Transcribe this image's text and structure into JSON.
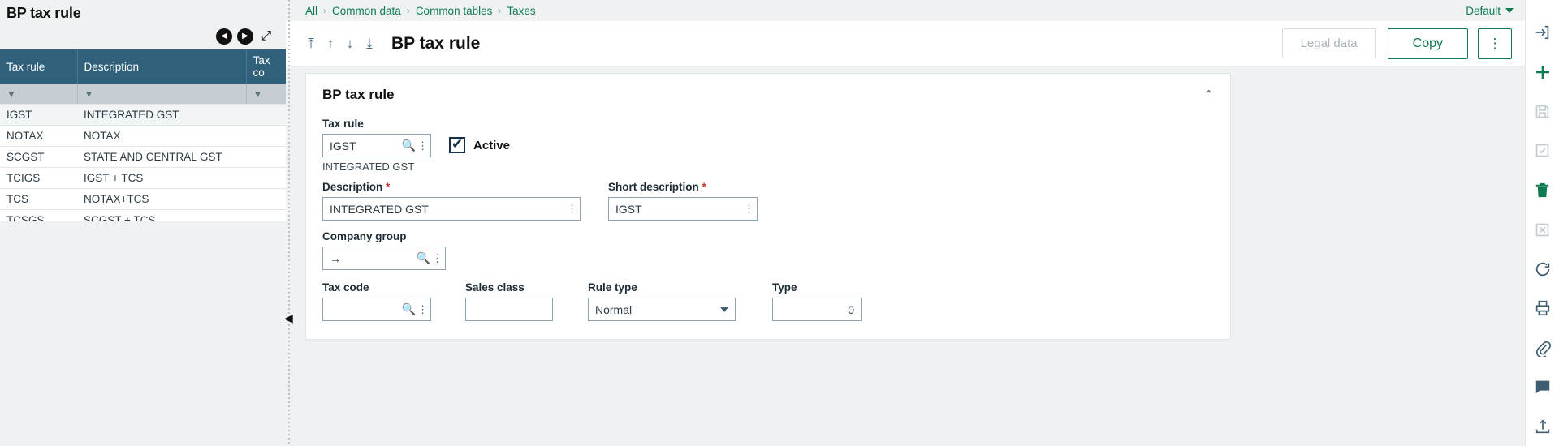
{
  "left_panel": {
    "title": "BP tax rule",
    "nav": {
      "prev_icon": "circle-left-arrow-icon",
      "next_icon": "circle-right-arrow-icon",
      "expand_icon": "expand-diagonal-icon"
    },
    "table": {
      "columns": [
        "Tax rule",
        "Description",
        "Tax co"
      ],
      "filter_icon": "funnel-filter-icon",
      "rows": [
        {
          "tax_rule": "IGST",
          "description": "INTEGRATED GST",
          "tax_code": "",
          "selected": true
        },
        {
          "tax_rule": "NOTAX",
          "description": "NOTAX",
          "tax_code": "",
          "selected": false
        },
        {
          "tax_rule": "SCGST",
          "description": "STATE AND CENTRAL GST",
          "tax_code": "",
          "selected": false
        },
        {
          "tax_rule": "TCIGS",
          "description": "IGST + TCS",
          "tax_code": "",
          "selected": false
        },
        {
          "tax_rule": "TCS",
          "description": "NOTAX+TCS",
          "tax_code": "",
          "selected": false
        },
        {
          "tax_rule": "TCSGS",
          "description": "SCGST + TCS",
          "tax_code": "",
          "selected": false
        }
      ]
    },
    "collapse_handle_icon": "collapse-left-arrow-icon"
  },
  "breadcrumb": {
    "items": [
      "All",
      "Common data",
      "Common tables",
      "Taxes"
    ],
    "separator": "›",
    "right": {
      "label": "Default",
      "caret_icon": "chevron-down-icon"
    }
  },
  "toolbar": {
    "nav_icons": [
      {
        "name": "go-to-first-record-icon",
        "glyph": "⤒"
      },
      {
        "name": "go-to-previous-record-icon",
        "glyph": "↑"
      },
      {
        "name": "go-to-next-record-icon",
        "glyph": "↓"
      },
      {
        "name": "go-to-last-record-icon",
        "glyph": "⤓"
      }
    ],
    "page_title": "BP tax rule",
    "legal_data_label": "Legal data",
    "copy_label": "Copy",
    "kebab_icon": "vertical-ellipsis-icon",
    "logout_icon": "logout-arrow-icon"
  },
  "form": {
    "section_title": "BP tax rule",
    "collapse_icon": "chevron-up-icon",
    "tax_rule": {
      "label": "Tax rule",
      "value": "IGST",
      "placeholder": "",
      "search_icon": "magnifier-search-icon",
      "menu_icon": "vertical-ellipsis-icon",
      "helper_text": "INTEGRATED GST"
    },
    "active": {
      "label": "Active",
      "checked": true,
      "check_icon": "checkmark-icon"
    },
    "description": {
      "label": "Description",
      "required_marker": "*",
      "value": "INTEGRATED GST",
      "menu_icon": "vertical-ellipsis-icon"
    },
    "short_description": {
      "label": "Short description",
      "required_marker": "*",
      "value": "IGST",
      "menu_icon": "vertical-ellipsis-icon"
    },
    "company_group": {
      "label": "Company group",
      "value": "→",
      "search_icon": "magnifier-search-icon",
      "menu_icon": "vertical-ellipsis-icon"
    },
    "tax_code": {
      "label": "Tax code",
      "value": "",
      "search_icon": "magnifier-search-icon",
      "menu_icon": "vertical-ellipsis-icon"
    },
    "sales_class": {
      "label": "Sales class",
      "value": ""
    },
    "rule_type": {
      "label": "Rule type",
      "value": "Normal",
      "caret_icon": "chevron-down-icon",
      "options": [
        "Normal"
      ]
    },
    "type": {
      "label": "Type",
      "value": "0"
    }
  },
  "right_rail": {
    "items": [
      {
        "name": "logout-icon",
        "glyph": "logout"
      },
      {
        "name": "add-icon",
        "glyph": "plus"
      },
      {
        "name": "save-icon",
        "glyph": "save"
      },
      {
        "name": "validate-icon",
        "glyph": "check"
      },
      {
        "name": "delete-icon",
        "glyph": "trash"
      },
      {
        "name": "cancel-icon",
        "glyph": "cross-box"
      },
      {
        "name": "refresh-icon",
        "glyph": "refresh"
      },
      {
        "name": "print-icon",
        "glyph": "printer"
      },
      {
        "name": "attach-icon",
        "glyph": "paperclip"
      },
      {
        "name": "comment-icon",
        "glyph": "chat"
      },
      {
        "name": "export-icon",
        "glyph": "upload"
      }
    ]
  }
}
